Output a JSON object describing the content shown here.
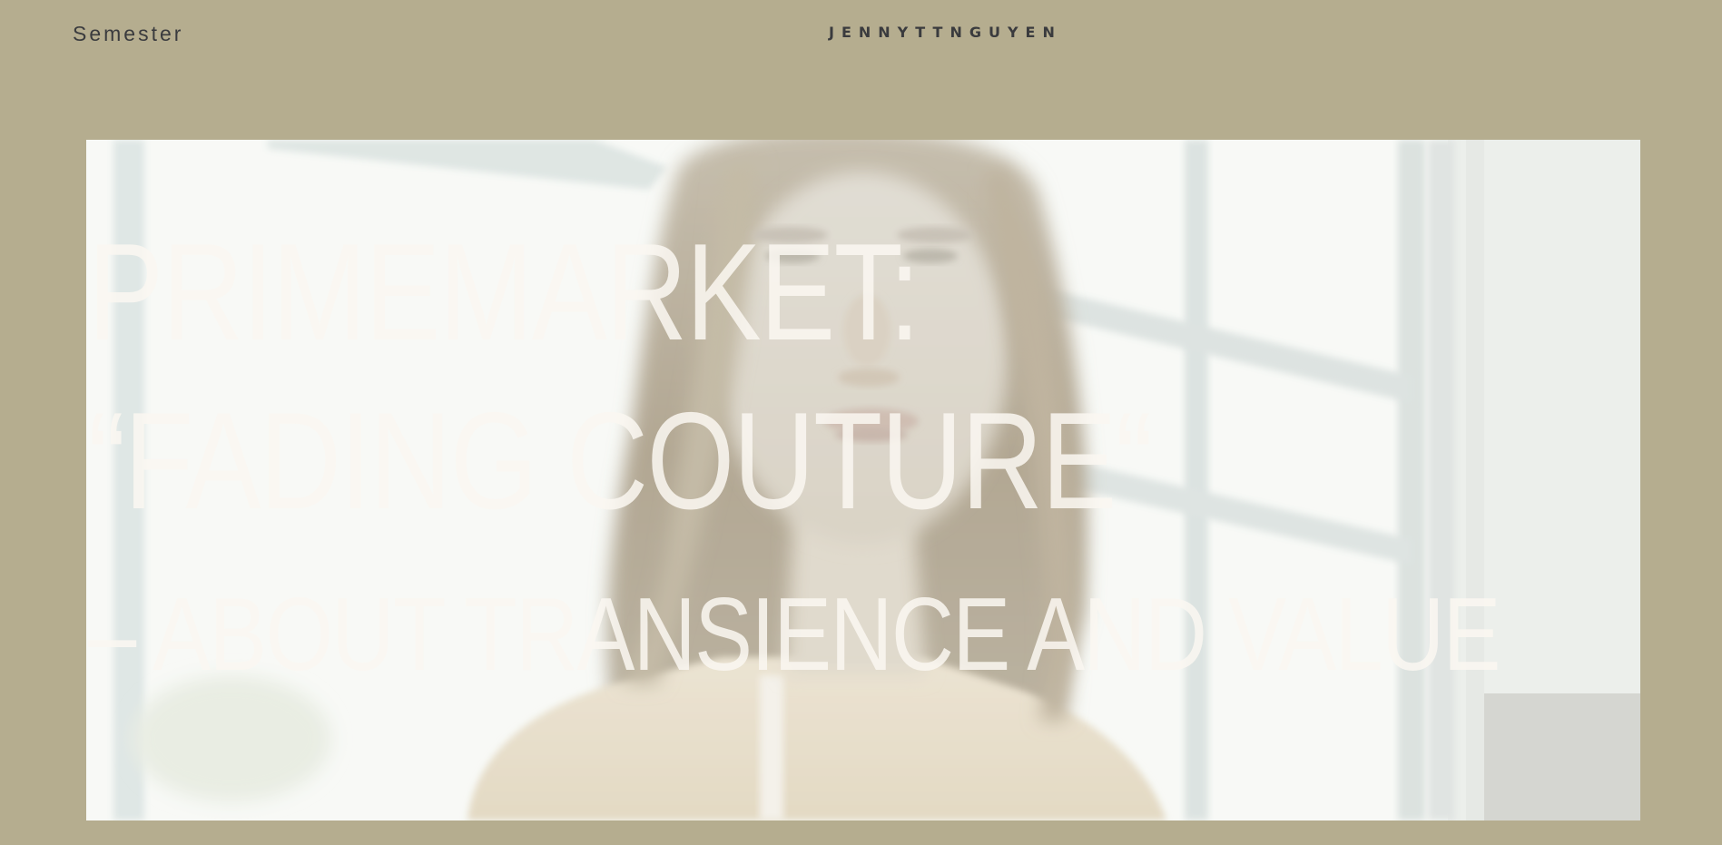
{
  "nav": {
    "semester_label": "Semester"
  },
  "header": {
    "brand": "JENNYTTNGUYEN"
  },
  "hero": {
    "title_line_1": "PRIMEMARKET:",
    "title_line_2": "“FADING COUTURE“",
    "subtitle": "– ABOUT TRANSIENCE AND VALUE"
  },
  "colors": {
    "background": "#b5ad8f",
    "text_dark": "#3a3b3e",
    "hero_text": "#faf7f1"
  }
}
